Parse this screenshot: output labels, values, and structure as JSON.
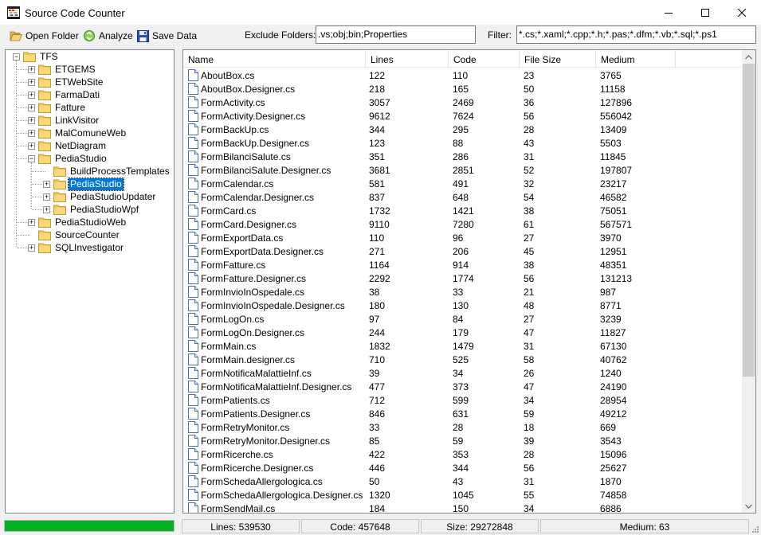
{
  "window": {
    "title": "Source Code Counter"
  },
  "toolbar": {
    "open_folder": "Open Folder",
    "analyze": "Analyze",
    "save_data": "Save Data",
    "exclude_label": "Exclude Folders:",
    "exclude_value": ".vs;obj;bin;Properties",
    "filter_label": "Filter:",
    "filter_value": "*.cs;*.xaml;*.cpp;*.h;*.pas;*.dfm;*.vb;*.sql;*.ps1"
  },
  "tree": {
    "root": "TFS",
    "nodes": [
      "ETGEMS",
      "ETWebSite",
      "FarmaDati",
      "Fatture",
      "LinkVisitor",
      "MalComuneWeb",
      "NetDiagram",
      "PediaStudio",
      "BuildProcessTemplates",
      "PediaStudio",
      "PediaStudioUpdater",
      "PediaStudioWpf",
      "PediaStudioWeb",
      "SourceCounter",
      "SQLInvestigator"
    ],
    "selected": "PediaStudio"
  },
  "list": {
    "columns": [
      "Name",
      "Lines",
      "Code",
      "File Size",
      "Medium"
    ],
    "rows": [
      [
        "AboutBox.cs",
        "122",
        "110",
        "23",
        "3765"
      ],
      [
        "AboutBox.Designer.cs",
        "218",
        "165",
        "50",
        "11158"
      ],
      [
        "FormActivity.cs",
        "3057",
        "2469",
        "36",
        "127896"
      ],
      [
        "FormActivity.Designer.cs",
        "9612",
        "7624",
        "56",
        "556042"
      ],
      [
        "FormBackUp.cs",
        "344",
        "295",
        "28",
        "13409"
      ],
      [
        "FormBackUp.Designer.cs",
        "123",
        "88",
        "43",
        "5503"
      ],
      [
        "FormBilanciSalute.cs",
        "351",
        "286",
        "31",
        "11845"
      ],
      [
        "FormBilanciSalute.Designer.cs",
        "3681",
        "2851",
        "52",
        "197807"
      ],
      [
        "FormCalendar.cs",
        "581",
        "491",
        "32",
        "23217"
      ],
      [
        "FormCalendar.Designer.cs",
        "837",
        "648",
        "54",
        "46582"
      ],
      [
        "FormCard.cs",
        "1732",
        "1421",
        "38",
        "75051"
      ],
      [
        "FormCard.Designer.cs",
        "9110",
        "7280",
        "61",
        "567571"
      ],
      [
        "FormExportData.cs",
        "110",
        "96",
        "27",
        "3970"
      ],
      [
        "FormExportData.Designer.cs",
        "271",
        "206",
        "45",
        "12951"
      ],
      [
        "FormFatture.cs",
        "1164",
        "914",
        "38",
        "48351"
      ],
      [
        "FormFatture.Designer.cs",
        "2292",
        "1774",
        "56",
        "131213"
      ],
      [
        "FormInvioInOspedale.cs",
        "38",
        "33",
        "21",
        "987"
      ],
      [
        "FormInvioInOspedale.Designer.cs",
        "180",
        "130",
        "48",
        "8771"
      ],
      [
        "FormLogOn.cs",
        "97",
        "84",
        "27",
        "3239"
      ],
      [
        "FormLogOn.Designer.cs",
        "244",
        "179",
        "47",
        "11827"
      ],
      [
        "FormMain.cs",
        "1832",
        "1479",
        "31",
        "67130"
      ],
      [
        "FormMain.designer.cs",
        "710",
        "525",
        "58",
        "40762"
      ],
      [
        "FormNotificaMalattieInf.cs",
        "39",
        "34",
        "26",
        "1240"
      ],
      [
        "FormNotificaMalattieInf.Designer.cs",
        "477",
        "373",
        "47",
        "24190"
      ],
      [
        "FormPatients.cs",
        "712",
        "599",
        "34",
        "28954"
      ],
      [
        "FormPatients.Designer.cs",
        "846",
        "631",
        "59",
        "49212"
      ],
      [
        "FormRetryMonitor.cs",
        "33",
        "28",
        "18",
        "669"
      ],
      [
        "FormRetryMonitor.Designer.cs",
        "85",
        "59",
        "39",
        "3543"
      ],
      [
        "FormRicerche.cs",
        "422",
        "353",
        "28",
        "15096"
      ],
      [
        "FormRicerche.Designer.cs",
        "446",
        "344",
        "56",
        "25627"
      ],
      [
        "FormSchedaAllergologica.cs",
        "50",
        "43",
        "31",
        "1870"
      ],
      [
        "FormSchedaAllergologica.Designer.cs",
        "1320",
        "1045",
        "55",
        "74858"
      ],
      [
        "FormSendMail.cs",
        "184",
        "150",
        "34",
        "6886"
      ]
    ]
  },
  "status": {
    "progress": 1.0,
    "progress_color": "#06b025",
    "lines": "Lines: 539530",
    "code": "Code: 457648",
    "size": "Size: 29272848",
    "medium": "Medium: 63"
  },
  "icons": {
    "app": "abacus-icon",
    "open_folder": "open-folder-icon",
    "analyze": "recycle-icon",
    "save": "floppy-disk-icon",
    "folder": "folder-icon",
    "file": "document-icon"
  }
}
